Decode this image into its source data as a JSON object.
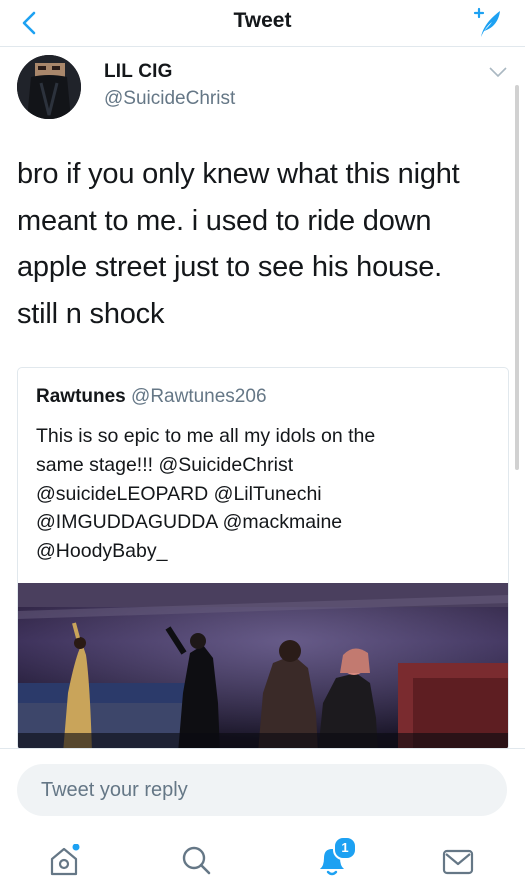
{
  "header": {
    "title": "Tweet",
    "back_icon": "chevron-left-icon",
    "compose_icon": "compose-tweet-icon",
    "accent": "#1da1f2"
  },
  "tweet": {
    "author_name": "LIL CIG",
    "author_handle": "@SuicideChrist",
    "lines": [
      "bro if you only knew what this night",
      "meant to me. i used to ride down",
      "apple street just to see his house.",
      "still n shock"
    ]
  },
  "quoted_tweet": {
    "author_name": "Rawtunes",
    "author_handle": "@Rawtunes206",
    "lines": [
      "This is so epic to me all my idols on the",
      "same stage!!! @SuicideChrist",
      "@suicideLEOPARD @LilTunechi",
      "@IMGUDDAGUDDA @mackmaine",
      "@HoodyBaby_"
    ]
  },
  "reply": {
    "placeholder": "Tweet your reply"
  },
  "tabbar": {
    "items": [
      {
        "icon": "home-icon",
        "has_dot": true
      },
      {
        "icon": "search-icon"
      },
      {
        "icon": "bell-icon",
        "badge": "1"
      },
      {
        "icon": "mail-icon"
      }
    ]
  }
}
